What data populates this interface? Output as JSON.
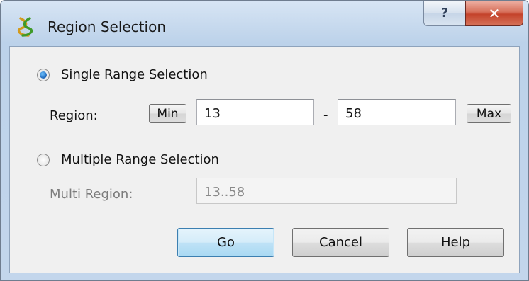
{
  "window": {
    "title": "Region Selection",
    "help_glyph": "?",
    "close_glyph": "✕"
  },
  "single": {
    "label": "Single Range Selection",
    "selected": true,
    "region_label": "Region:",
    "min_label": "Min",
    "start_value": "13",
    "dash": "-",
    "end_value": "58",
    "max_label": "Max"
  },
  "multi": {
    "label": "Multiple Range Selection",
    "selected": false,
    "region_label": "Multi Region:",
    "value": "13..58"
  },
  "buttons": {
    "go": "Go",
    "cancel": "Cancel",
    "help": "Help"
  },
  "icons": {
    "app": "helix-app-icon",
    "help": "question-mark-icon",
    "close": "close-icon"
  }
}
